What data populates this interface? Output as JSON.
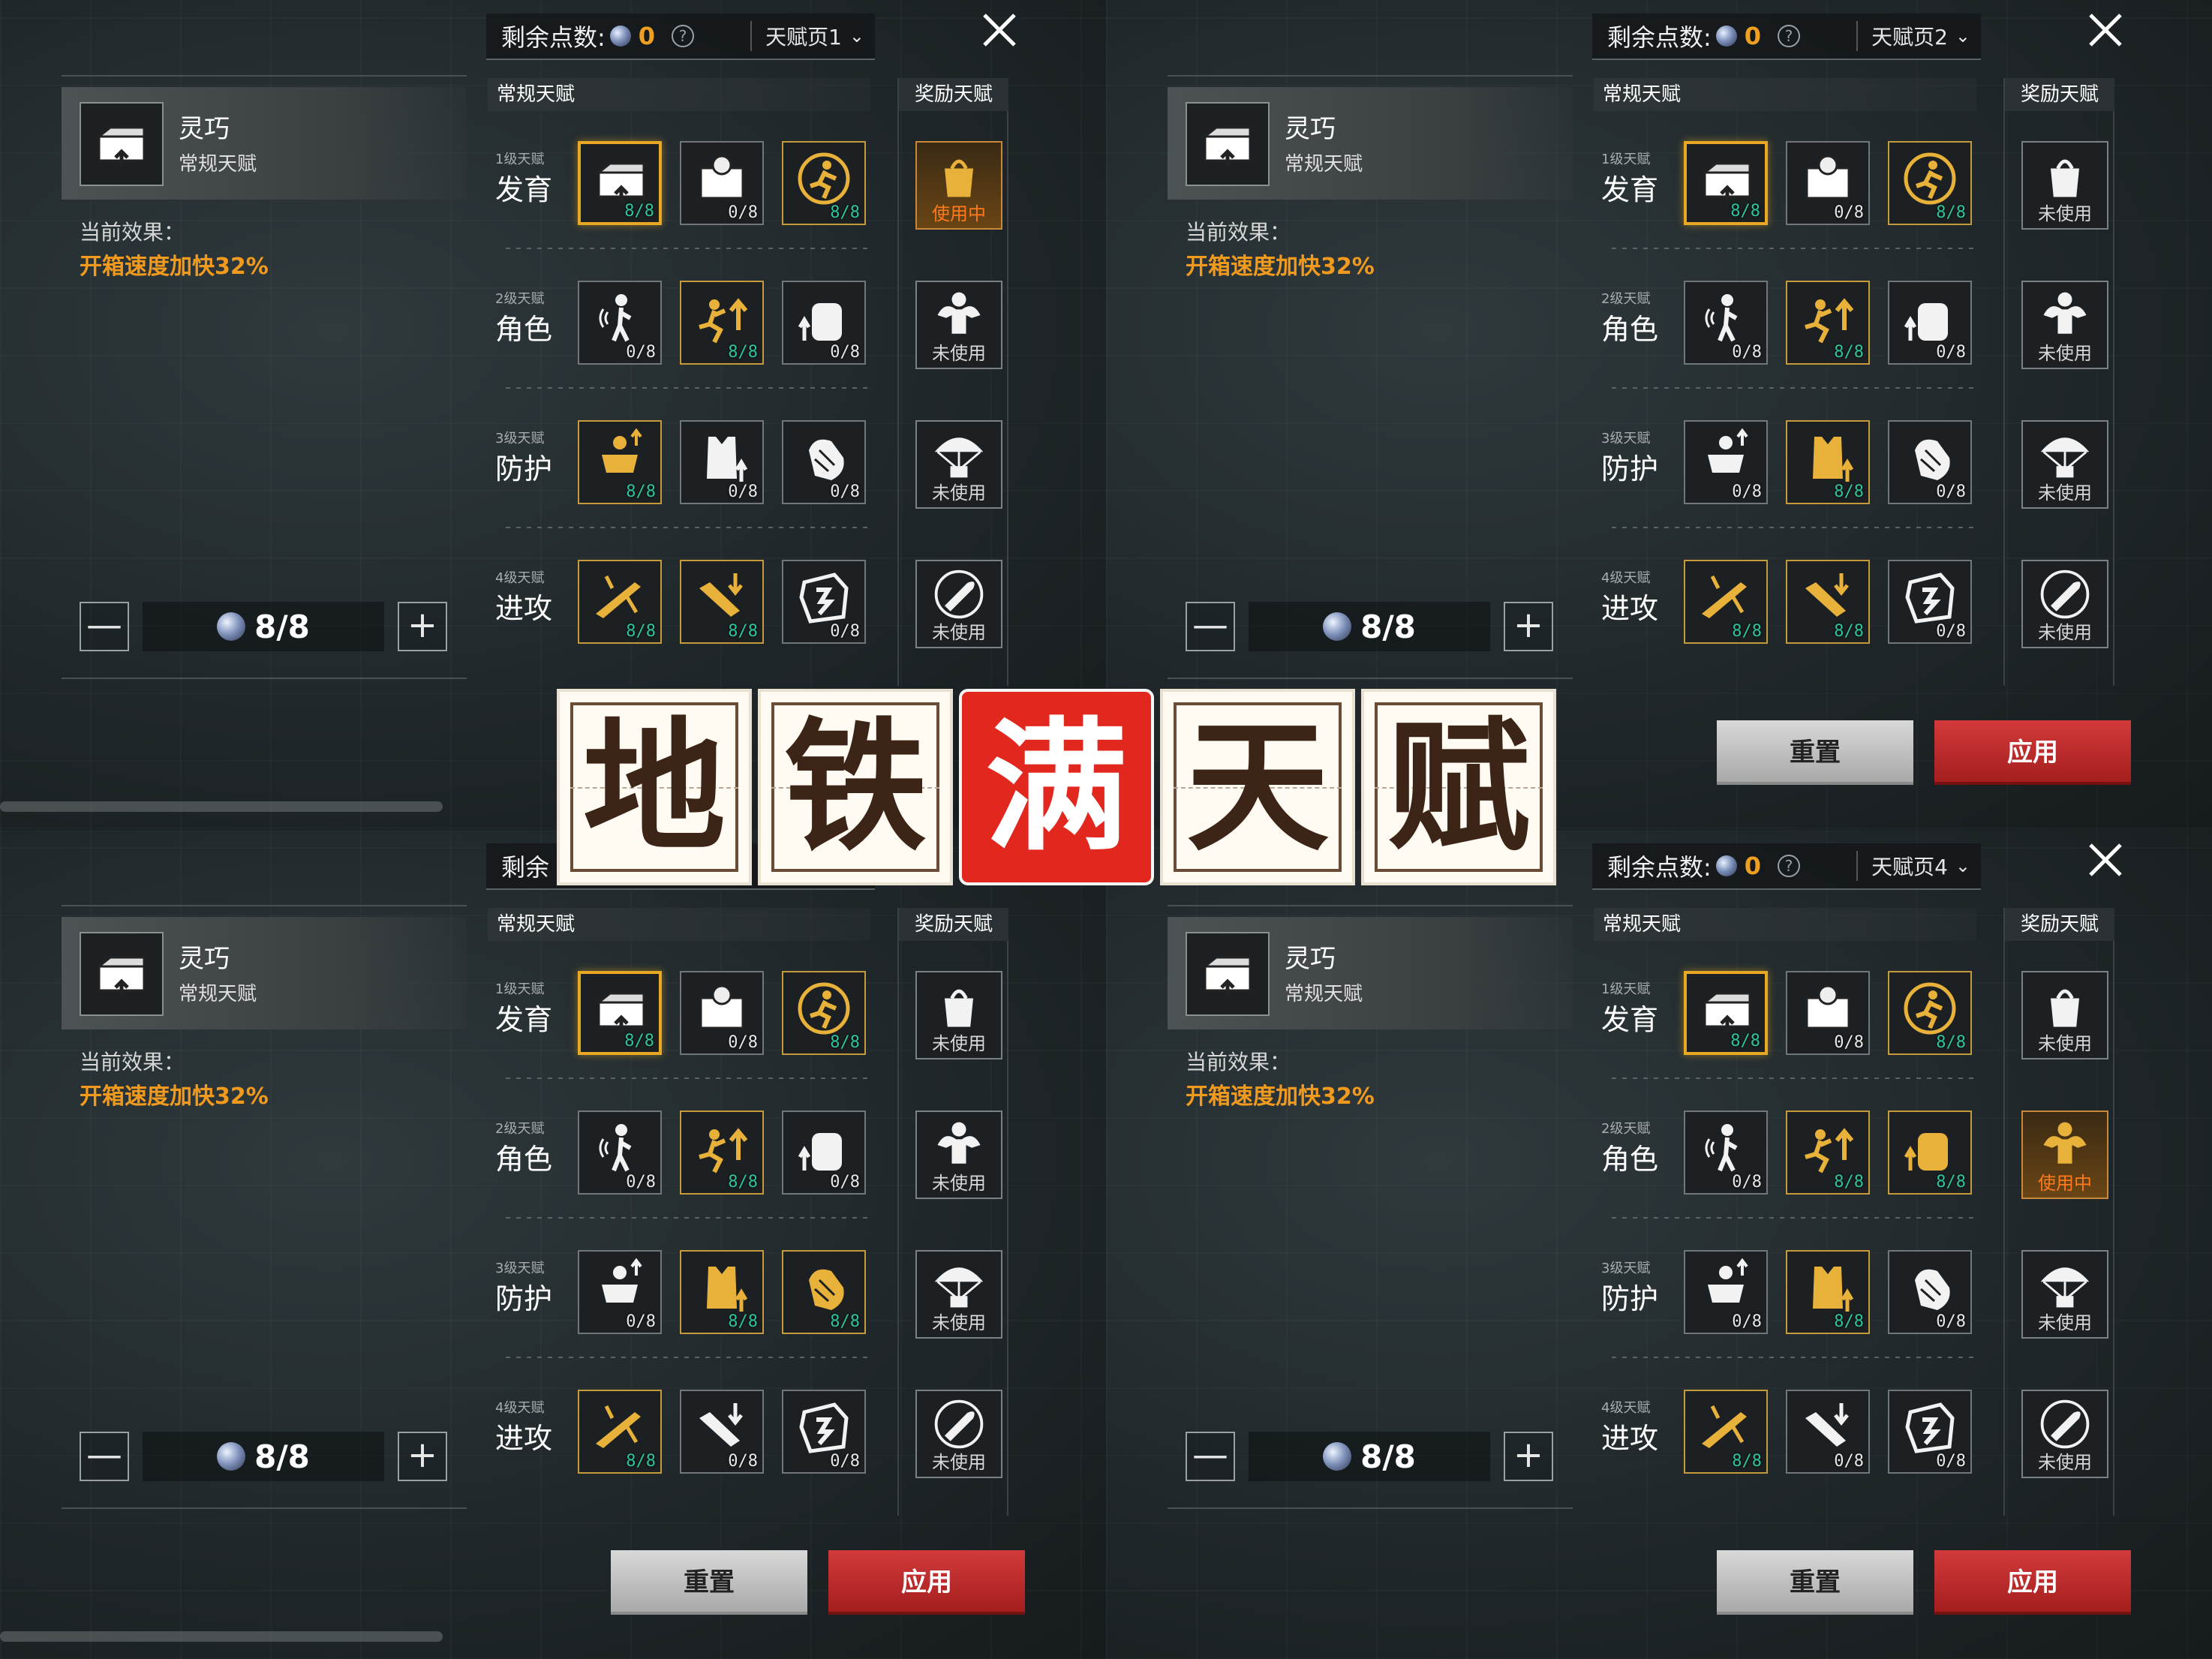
{
  "colors": {
    "accent_orange": "#f29a1e",
    "maxed_level": "#2fc49a",
    "apply_red": "#c42a2a",
    "active_gold": "#e9a823"
  },
  "title_banner": {
    "chars": [
      "地",
      "铁",
      "满",
      "天",
      "赋"
    ]
  },
  "panels": [
    {
      "header": {
        "remaining_label": "剩余点数:",
        "remaining_points": "0",
        "help": "?",
        "page": "天赋页1"
      },
      "selected": {
        "name": "灵巧",
        "type": "常规天赋",
        "icon": "crate-icon"
      },
      "effect": {
        "label": "当前效果：",
        "value": "开箱速度加快32%"
      },
      "stepper": {
        "minus": "—",
        "plus": "+",
        "value": "8/8"
      },
      "regular_title": "常规天赋",
      "bonus_title": "奖励天赋",
      "rows": [
        {
          "tier": "1级天赋",
          "name": "发育",
          "cells": [
            {
              "icon": "crate-icon",
              "level": "8/8",
              "maxed": true,
              "selected": true
            },
            {
              "icon": "supply-box-icon",
              "level": "0/8",
              "maxed": false
            },
            {
              "icon": "runner-coin-icon",
              "level": "8/8",
              "maxed": true
            }
          ]
        },
        {
          "tier": "2级天赋",
          "name": "角色",
          "cells": [
            {
              "icon": "soldier-sound-icon",
              "level": "0/8",
              "maxed": false
            },
            {
              "icon": "sprint-up-icon",
              "level": "8/8",
              "maxed": true
            },
            {
              "icon": "backpack-up-icon",
              "level": "0/8",
              "maxed": false
            }
          ]
        },
        {
          "tier": "3级天赋",
          "name": "防护",
          "cells": [
            {
              "icon": "armor-man-icon",
              "level": "8/8",
              "maxed": true
            },
            {
              "icon": "vest-up-icon",
              "level": "0/8",
              "maxed": false
            },
            {
              "icon": "glove-icon",
              "level": "0/8",
              "maxed": false
            }
          ]
        },
        {
          "tier": "4级天赋",
          "name": "进攻",
          "cells": [
            {
              "icon": "rifle-fire-icon",
              "level": "8/8",
              "maxed": true
            },
            {
              "icon": "gun-down-icon",
              "level": "8/8",
              "maxed": true
            },
            {
              "icon": "ammo-box-icon",
              "level": "0/8",
              "maxed": false
            }
          ]
        }
      ],
      "bonus": [
        {
          "icon": "bag-icon",
          "status": "使用中",
          "active": true
        },
        {
          "icon": "muscle-icon",
          "status": "未使用",
          "active": false
        },
        {
          "icon": "parachute-icon",
          "status": "未使用",
          "active": false
        },
        {
          "icon": "bullet-icon",
          "status": "未使用",
          "active": false
        }
      ],
      "buttons": null
    },
    {
      "header": {
        "remaining_label": "剩余点数:",
        "remaining_points": "0",
        "help": "?",
        "page": "天赋页2"
      },
      "selected": {
        "name": "灵巧",
        "type": "常规天赋",
        "icon": "crate-icon"
      },
      "effect": {
        "label": "当前效果：",
        "value": "开箱速度加快32%"
      },
      "stepper": {
        "minus": "—",
        "plus": "+",
        "value": "8/8"
      },
      "regular_title": "常规天赋",
      "bonus_title": "奖励天赋",
      "rows": [
        {
          "tier": "1级天赋",
          "name": "发育",
          "cells": [
            {
              "icon": "crate-icon",
              "level": "8/8",
              "maxed": true,
              "selected": true
            },
            {
              "icon": "supply-box-icon",
              "level": "0/8",
              "maxed": false
            },
            {
              "icon": "runner-coin-icon",
              "level": "8/8",
              "maxed": true
            }
          ]
        },
        {
          "tier": "2级天赋",
          "name": "角色",
          "cells": [
            {
              "icon": "soldier-sound-icon",
              "level": "0/8",
              "maxed": false
            },
            {
              "icon": "sprint-up-icon",
              "level": "8/8",
              "maxed": true
            },
            {
              "icon": "backpack-up-icon",
              "level": "0/8",
              "maxed": false
            }
          ]
        },
        {
          "tier": "3级天赋",
          "name": "防护",
          "cells": [
            {
              "icon": "armor-man-icon",
              "level": "0/8",
              "maxed": false
            },
            {
              "icon": "vest-up-icon",
              "level": "8/8",
              "maxed": true
            },
            {
              "icon": "glove-icon",
              "level": "0/8",
              "maxed": false
            }
          ]
        },
        {
          "tier": "4级天赋",
          "name": "进攻",
          "cells": [
            {
              "icon": "rifle-fire-icon",
              "level": "8/8",
              "maxed": true
            },
            {
              "icon": "gun-down-icon",
              "level": "8/8",
              "maxed": true
            },
            {
              "icon": "ammo-box-icon",
              "level": "0/8",
              "maxed": false
            }
          ]
        }
      ],
      "bonus": [
        {
          "icon": "bag-icon",
          "status": "未使用",
          "active": false
        },
        {
          "icon": "muscle-icon",
          "status": "未使用",
          "active": false
        },
        {
          "icon": "parachute-icon",
          "status": "未使用",
          "active": false
        },
        {
          "icon": "bullet-icon",
          "status": "未使用",
          "active": false
        }
      ],
      "buttons": {
        "reset": "重置",
        "apply": "应用"
      }
    },
    {
      "header": {
        "remaining_label": "剩余",
        "remaining_points": "",
        "help": "",
        "page": ""
      },
      "selected": {
        "name": "灵巧",
        "type": "常规天赋",
        "icon": "crate-icon"
      },
      "effect": {
        "label": "当前效果：",
        "value": "开箱速度加快32%"
      },
      "stepper": {
        "minus": "—",
        "plus": "+",
        "value": "8/8"
      },
      "regular_title": "常规天赋",
      "bonus_title": "奖励天赋",
      "rows": [
        {
          "tier": "1级天赋",
          "name": "发育",
          "cells": [
            {
              "icon": "crate-icon",
              "level": "8/8",
              "maxed": true,
              "selected": true
            },
            {
              "icon": "supply-box-icon",
              "level": "0/8",
              "maxed": false
            },
            {
              "icon": "runner-coin-icon",
              "level": "8/8",
              "maxed": true
            }
          ]
        },
        {
          "tier": "2级天赋",
          "name": "角色",
          "cells": [
            {
              "icon": "soldier-sound-icon",
              "level": "0/8",
              "maxed": false
            },
            {
              "icon": "sprint-up-icon",
              "level": "8/8",
              "maxed": true
            },
            {
              "icon": "backpack-up-icon",
              "level": "0/8",
              "maxed": false
            }
          ]
        },
        {
          "tier": "3级天赋",
          "name": "防护",
          "cells": [
            {
              "icon": "armor-man-icon",
              "level": "0/8",
              "maxed": false
            },
            {
              "icon": "vest-up-icon",
              "level": "8/8",
              "maxed": true
            },
            {
              "icon": "glove-icon",
              "level": "8/8",
              "maxed": true
            }
          ]
        },
        {
          "tier": "4级天赋",
          "name": "进攻",
          "cells": [
            {
              "icon": "rifle-fire-icon",
              "level": "8/8",
              "maxed": true
            },
            {
              "icon": "gun-down-icon",
              "level": "0/8",
              "maxed": false
            },
            {
              "icon": "ammo-box-icon",
              "level": "0/8",
              "maxed": false
            }
          ]
        }
      ],
      "bonus": [
        {
          "icon": "bag-icon",
          "status": "未使用",
          "active": false
        },
        {
          "icon": "muscle-icon",
          "status": "未使用",
          "active": false
        },
        {
          "icon": "parachute-icon",
          "status": "未使用",
          "active": false
        },
        {
          "icon": "bullet-icon",
          "status": "未使用",
          "active": false
        }
      ],
      "buttons": {
        "reset": "重置",
        "apply": "应用"
      }
    },
    {
      "header": {
        "remaining_label": "剩余点数:",
        "remaining_points": "0",
        "help": "?",
        "page": "天赋页4"
      },
      "selected": {
        "name": "灵巧",
        "type": "常规天赋",
        "icon": "crate-icon"
      },
      "effect": {
        "label": "当前效果：",
        "value": "开箱速度加快32%"
      },
      "stepper": {
        "minus": "—",
        "plus": "+",
        "value": "8/8"
      },
      "regular_title": "常规天赋",
      "bonus_title": "奖励天赋",
      "rows": [
        {
          "tier": "1级天赋",
          "name": "发育",
          "cells": [
            {
              "icon": "crate-icon",
              "level": "8/8",
              "maxed": true,
              "selected": true
            },
            {
              "icon": "supply-box-icon",
              "level": "0/8",
              "maxed": false
            },
            {
              "icon": "runner-coin-icon",
              "level": "8/8",
              "maxed": true
            }
          ]
        },
        {
          "tier": "2级天赋",
          "name": "角色",
          "cells": [
            {
              "icon": "soldier-sound-icon",
              "level": "0/8",
              "maxed": false
            },
            {
              "icon": "sprint-up-icon",
              "level": "8/8",
              "maxed": true
            },
            {
              "icon": "backpack-up-icon",
              "level": "8/8",
              "maxed": true
            }
          ]
        },
        {
          "tier": "3级天赋",
          "name": "防护",
          "cells": [
            {
              "icon": "armor-man-icon",
              "level": "0/8",
              "maxed": false
            },
            {
              "icon": "vest-up-icon",
              "level": "8/8",
              "maxed": true
            },
            {
              "icon": "glove-icon",
              "level": "0/8",
              "maxed": false
            }
          ]
        },
        {
          "tier": "4级天赋",
          "name": "进攻",
          "cells": [
            {
              "icon": "rifle-fire-icon",
              "level": "8/8",
              "maxed": true
            },
            {
              "icon": "gun-down-icon",
              "level": "0/8",
              "maxed": false
            },
            {
              "icon": "ammo-box-icon",
              "level": "0/8",
              "maxed": false
            }
          ]
        }
      ],
      "bonus": [
        {
          "icon": "bag-icon",
          "status": "未使用",
          "active": false
        },
        {
          "icon": "muscle-icon",
          "status": "使用中",
          "active": true
        },
        {
          "icon": "parachute-icon",
          "status": "未使用",
          "active": false
        },
        {
          "icon": "bullet-icon",
          "status": "未使用",
          "active": false
        }
      ],
      "buttons": {
        "reset": "重置",
        "apply": "应用"
      }
    }
  ]
}
